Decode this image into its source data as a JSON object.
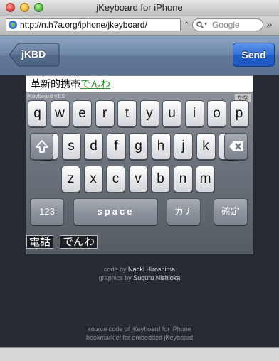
{
  "window": {
    "title": "jKeyboard for iPhone"
  },
  "toolbar": {
    "url": "http://n.h7a.org/iphone/jkeyboard/",
    "search_placeholder": "Google"
  },
  "nav": {
    "back_label": "jKBD",
    "send_label": "Send"
  },
  "input": {
    "committed_text": "革新的携帯",
    "composing_text": "でんわ"
  },
  "keyboard": {
    "version": "jKeyboard v1.5",
    "mode_badge": "かな",
    "row1": [
      "q",
      "w",
      "e",
      "r",
      "t",
      "y",
      "u",
      "i",
      "o",
      "p"
    ],
    "row2": [
      "a",
      "s",
      "d",
      "f",
      "g",
      "h",
      "j",
      "k",
      "l"
    ],
    "row3": [
      "z",
      "x",
      "c",
      "v",
      "b",
      "n",
      "m"
    ],
    "numbers_label": "123",
    "space_label": "space",
    "kana_label": "カナ",
    "confirm_label": "確定"
  },
  "candidates": [
    "電話",
    "でんわ"
  ],
  "credits": {
    "code_prefix": "code by",
    "code_author": "Naoki Hiroshima",
    "graphics_prefix": "graphics by",
    "graphics_author": "Suguru Nishioka",
    "source_link": "source code of jKeyboard for iPhone",
    "bookmarklet_link": "bookmarklet for embedded jKeyboard"
  }
}
